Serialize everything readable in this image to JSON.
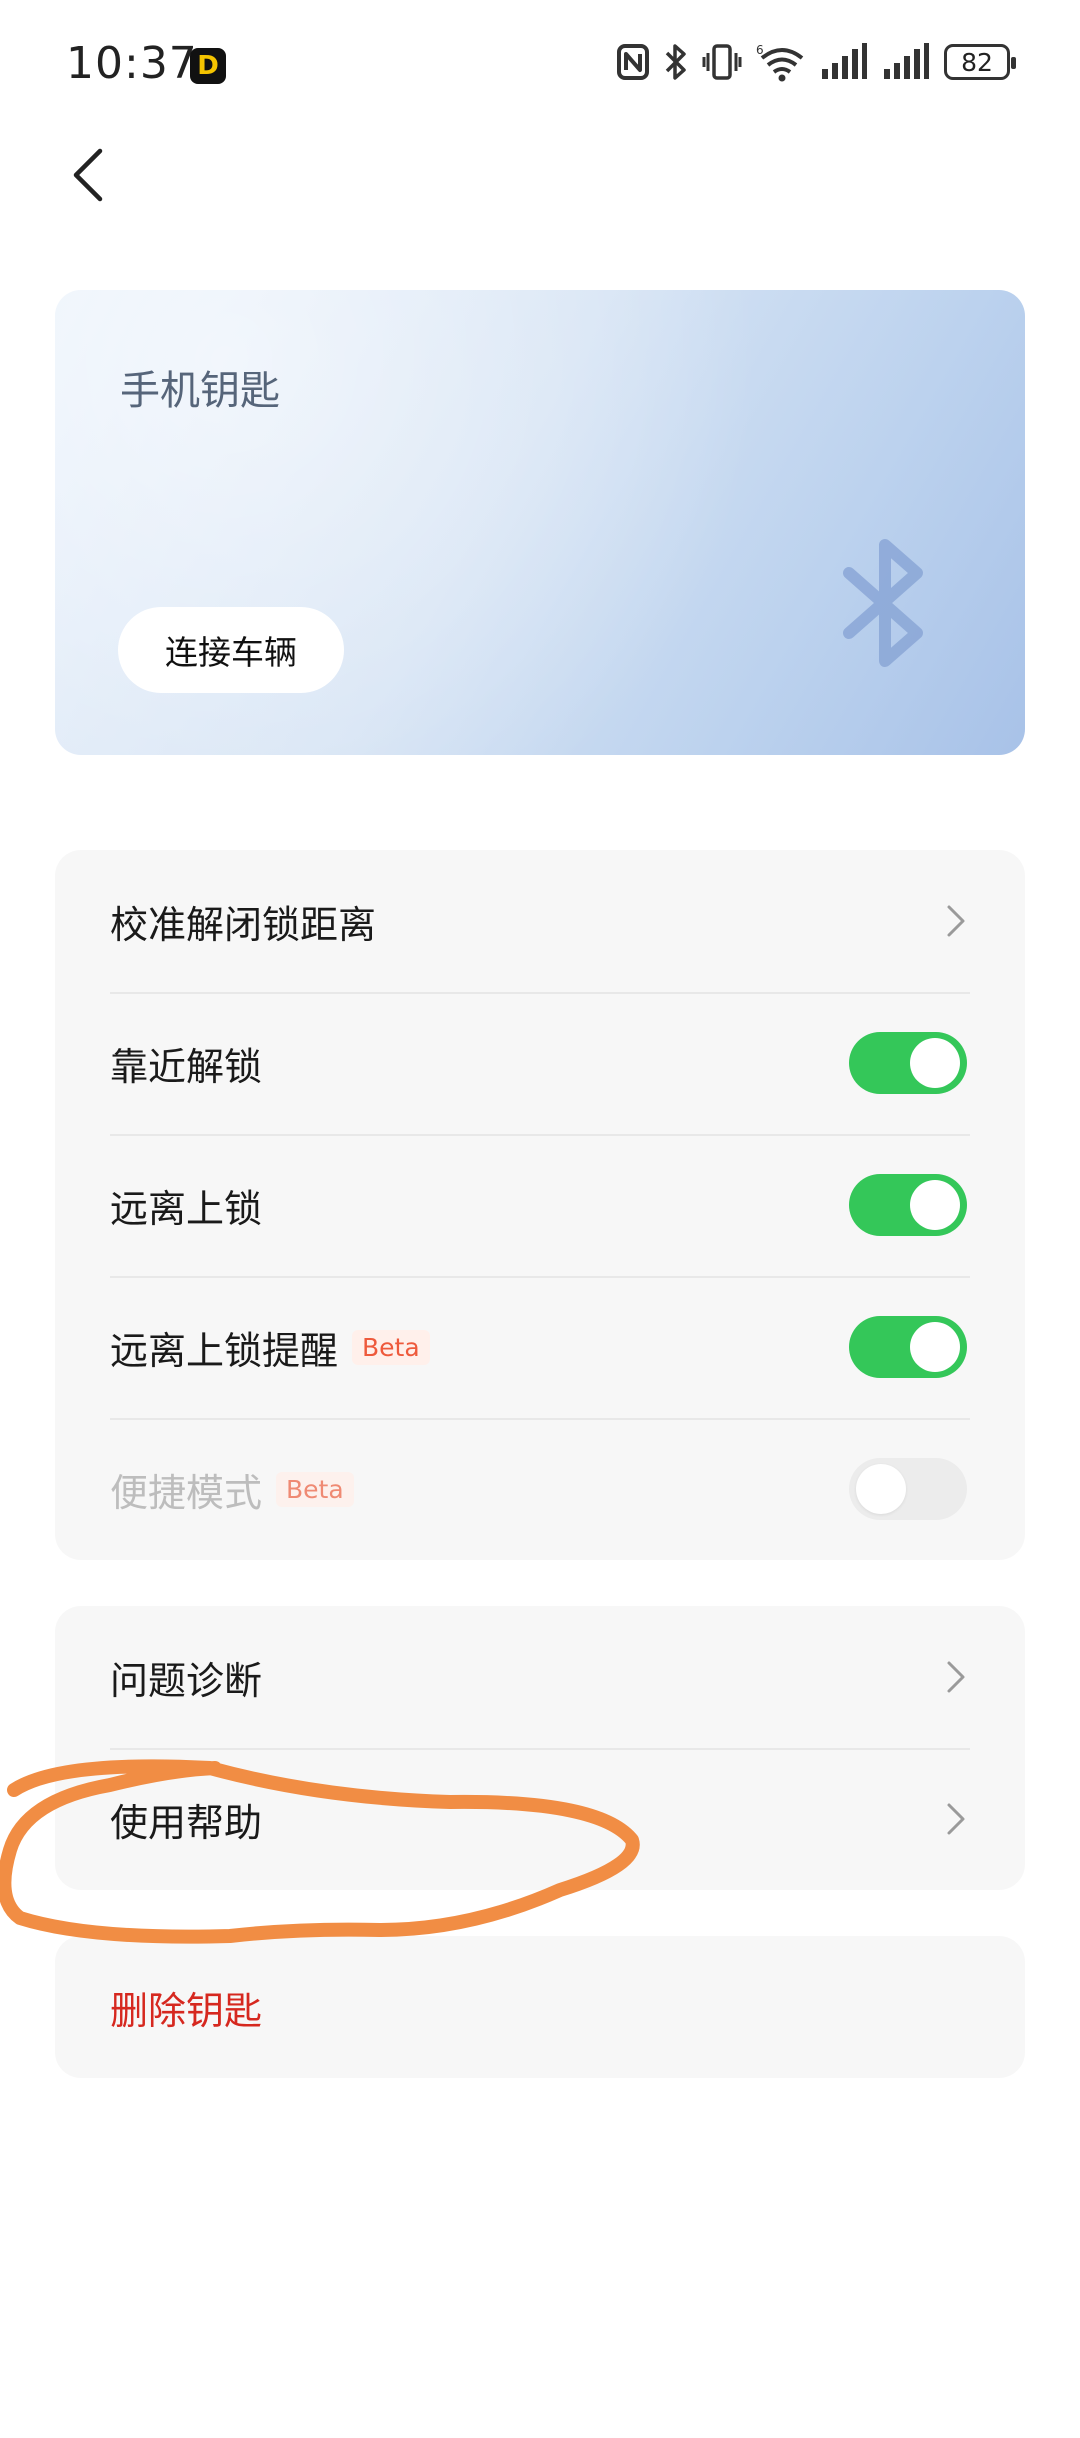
{
  "status_bar": {
    "time": "10:37",
    "app_badge": "D",
    "battery": "82"
  },
  "card": {
    "title": "手机钥匙",
    "connect_button": "连接车辆"
  },
  "settings": {
    "rows": [
      {
        "label": "校准解闭锁距离"
      },
      {
        "label": "靠近解锁",
        "toggle": true
      },
      {
        "label": "远离上锁",
        "toggle": true
      },
      {
        "label": "远离上锁提醒",
        "badge": "Beta",
        "toggle": true
      },
      {
        "label": "便捷模式",
        "badge": "Beta",
        "toggle": false,
        "disabled": true
      }
    ]
  },
  "support": {
    "rows": [
      {
        "label": "问题诊断"
      },
      {
        "label": "使用帮助"
      }
    ]
  },
  "danger": {
    "label": "删除钥匙"
  },
  "colors": {
    "toggle_on": "#34c759",
    "danger": "#d6281f",
    "beta": "#ee5a3c",
    "scribble": "#f0873a"
  }
}
